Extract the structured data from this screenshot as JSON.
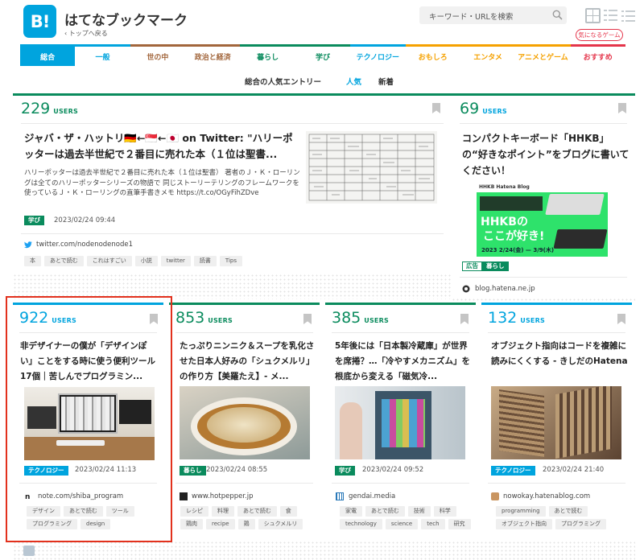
{
  "header": {
    "logo_text": "B!",
    "brand": "はてなブックマーク",
    "back_link": "‹ トップへ戻る",
    "search_placeholder": "キーワード・URLを検索",
    "fav_game_label": "気になるゲーム"
  },
  "nav": {
    "categories": [
      {
        "label": "総合",
        "color": "#00a4de",
        "active": true
      },
      {
        "label": "一般",
        "color": "#00a4de"
      },
      {
        "label": "世の中",
        "color": "#a2663c"
      },
      {
        "label": "政治と経済",
        "color": "#a2663c"
      },
      {
        "label": "暮らし",
        "color": "#0a8b5d"
      },
      {
        "label": "学び",
        "color": "#0a8b5d"
      },
      {
        "label": "テクノロジー",
        "color": "#00a4de"
      },
      {
        "label": "おもしろ",
        "color": "#f5a100"
      },
      {
        "label": "エンタメ",
        "color": "#f5a100"
      },
      {
        "label": "アニメとゲーム",
        "color": "#f5a100"
      },
      {
        "label": "おすすめ",
        "color": "#e4344a"
      }
    ]
  },
  "subnav": {
    "title": "総合の人気エントリー",
    "popular": "人気",
    "new": "新着"
  },
  "entries": [
    {
      "users": "229",
      "users_label": "USERS",
      "title": "ジャバ・ザ・ハットリ🇩🇪←🇸🇬←🇯🇵 on Twitter: \"ハリーポッターは過去半世紀で２番目に売れた本（１位は聖書...",
      "description": "ハリーポッターは過去半世紀で２番目に売れた本（１位は聖書） 著者のＪ・Ｋ・ローリングは全てのハリーポッターシリーズの物語で 同じストーリーテリングのフレームワークを使っているＪ・Ｋ・ローリングの直筆手書きメモ https://t.co/OGyFihZDve",
      "category": "学び",
      "category_color": "#0a8b5d",
      "date": "2023/02/24 09:44",
      "domain": "twitter.com/nodenodenode1",
      "tags": [
        "本",
        "あとで読む",
        "これはすごい",
        "小説",
        "twitter",
        "読書",
        "Tips"
      ]
    },
    {
      "users": "69",
      "users_label": "USERS",
      "title": "コンパクトキーボード「HHKB」の“好きなポイント”をブログに書いてください！",
      "ad_label": "広告",
      "category": "暮らし",
      "category_color": "#0a8b5d",
      "domain": "blog.hatena.ne.jp",
      "promo": {
        "brand": "HHKB  Hatena Blog",
        "headline1": "HHKBの",
        "headline2": "ここが好き!",
        "dates": "2023 2/24(金) — 3/9(木)"
      }
    },
    {
      "users": "922",
      "users_label": "USERS",
      "title": "非デザイナーの僕が「デザインぽい」ことをする時に使う便利ツール17個｜苦しんでプログラミン...",
      "category": "テクノロジー",
      "category_color": "#00a4de",
      "date": "2023/02/24 11:13",
      "domain": "note.com/shiba_program",
      "tags": [
        "デザイン",
        "あとで読む",
        "ツール",
        "プログラミング",
        "design"
      ]
    },
    {
      "users": "853",
      "users_label": "USERS",
      "title": "たっぷりニンニク＆スープを乳化させた日本人好みの「シュクメルリ」の作り方【美羅たえ】- メ...",
      "category": "暮らし",
      "category_color": "#0a8b5d",
      "date": "2023/02/24 08:55",
      "domain": "www.hotpepper.jp",
      "tags": [
        "レシピ",
        "料理",
        "あとで読む",
        "食",
        "鶏肉",
        "recipe",
        "鶏",
        "シュクメルリ"
      ]
    },
    {
      "users": "385",
      "users_label": "USERS",
      "title": "5年後には「日本製冷蔵庫」が世界を席捲？…「冷やすメカニズム」を根底から変える「磁気冷...",
      "category": "学び",
      "category_color": "#0a8b5d",
      "date": "2023/02/24 09:52",
      "domain": "gendai.media",
      "tags": [
        "家電",
        "あとで読む",
        "技術",
        "科学",
        "technology",
        "science",
        "tech",
        "研究"
      ]
    },
    {
      "users": "132",
      "users_label": "USERS",
      "title": "オブジェクト指向はコードを複雑に読みにくくする - きしだのHatena",
      "category": "テクノロジー",
      "category_color": "#00a4de",
      "date": "2023/02/24 21:40",
      "domain": "nowokay.hatenablog.com",
      "tags": [
        "programming",
        "あとで読む",
        "オブジェクト指向",
        "プログラミング"
      ]
    }
  ]
}
